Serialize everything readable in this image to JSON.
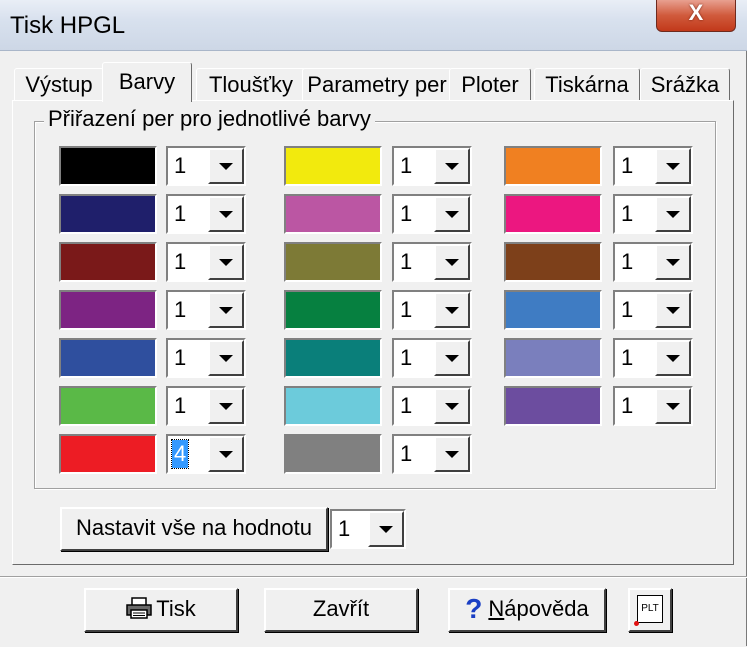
{
  "window": {
    "title": "Tisk HPGL",
    "close_label": "X"
  },
  "tabs": [
    {
      "label": "Výstup"
    },
    {
      "label": "Barvy"
    },
    {
      "label": "Tloušťky"
    },
    {
      "label": "Parametry per"
    },
    {
      "label": "Ploter"
    },
    {
      "label": "Tiskárna"
    },
    {
      "label": "Srážka"
    }
  ],
  "active_tab": "Barvy",
  "group": {
    "label": "Přiřazení per pro jednotlivé barvy"
  },
  "colors": [
    {
      "color": "#000000",
      "pen": "1"
    },
    {
      "color": "#1f1f6b",
      "pen": "1"
    },
    {
      "color": "#7a1919",
      "pen": "1"
    },
    {
      "color": "#7d2483",
      "pen": "1"
    },
    {
      "color": "#2f4f9e",
      "pen": "1"
    },
    {
      "color": "#5ab947",
      "pen": "1"
    },
    {
      "color": "#ed1c24",
      "pen": "4"
    },
    {
      "color": "#f2ea0d",
      "pen": "1"
    },
    {
      "color": "#bb56a3",
      "pen": "1"
    },
    {
      "color": "#7d7a36",
      "pen": "1"
    },
    {
      "color": "#068040",
      "pen": "1"
    },
    {
      "color": "#0a7f7a",
      "pen": "1"
    },
    {
      "color": "#6ccbdb",
      "pen": "1"
    },
    {
      "color": "#808080",
      "pen": "1"
    },
    {
      "color": "#f08021",
      "pen": "1"
    },
    {
      "color": "#ec1780",
      "pen": "1"
    },
    {
      "color": "#7d401a",
      "pen": "1"
    },
    {
      "color": "#3f7cc3",
      "pen": "1"
    },
    {
      "color": "#7a7fbd",
      "pen": "1"
    },
    {
      "color": "#6c4d9f",
      "pen": "1"
    }
  ],
  "set_all": {
    "button_label": "Nastavit vše na hodnotu",
    "value": "1"
  },
  "footer": {
    "print_label": "Tisk",
    "close_label": "Zavřít",
    "help_mnemonic": "N",
    "help_rest": "ápověda",
    "plt_label": "PLT"
  }
}
